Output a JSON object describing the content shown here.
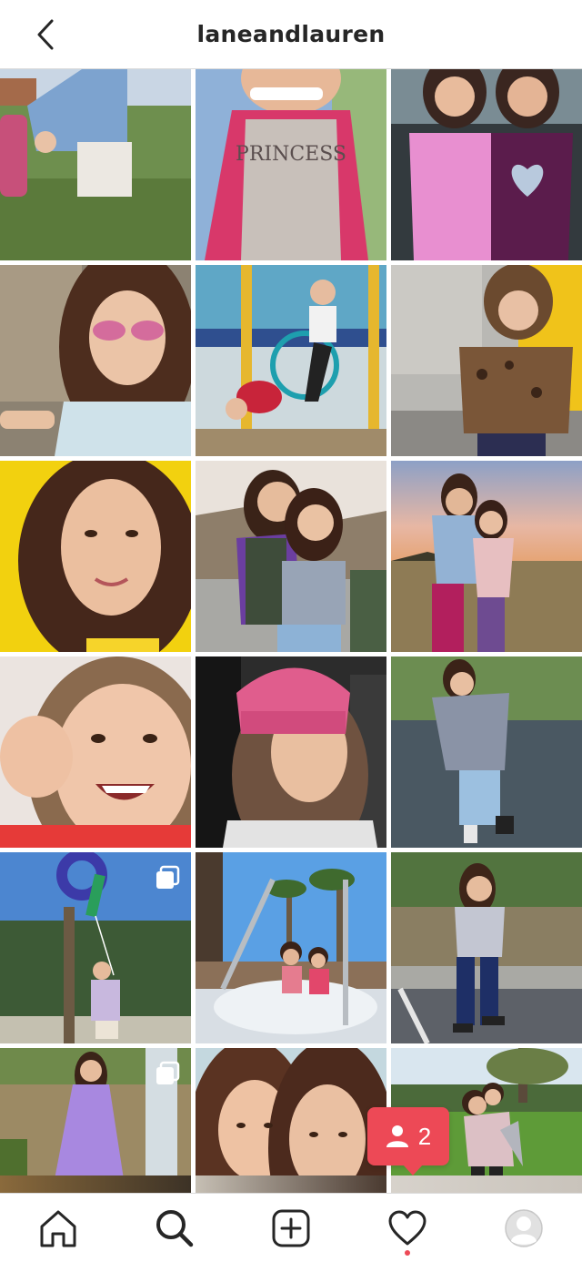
{
  "header": {
    "title": "laneandlauren"
  },
  "colors": {
    "accent": "#ed4956",
    "text": "#262626",
    "border": "#dbdbdb"
  },
  "grid": {
    "tiles": [
      {
        "scene": "girl-denim-jacket-park",
        "multi": false
      },
      {
        "scene": "girl-princess-shirt",
        "multi": false
      },
      {
        "scene": "two-girls-pink-purple",
        "multi": false
      },
      {
        "scene": "girl-pink-sunglasses",
        "multi": false
      },
      {
        "scene": "girls-playground-climbing",
        "multi": false
      },
      {
        "scene": "girl-leopard-coat-yellow-door",
        "multi": false
      },
      {
        "scene": "girl-portrait-yellow-background",
        "multi": false
      },
      {
        "scene": "two-girls-hugging-sunset-path",
        "multi": false
      },
      {
        "scene": "two-girls-sunset-field",
        "multi": false
      },
      {
        "scene": "girl-smiling-closeup",
        "multi": false
      },
      {
        "scene": "girl-pink-beanie-car",
        "multi": false
      },
      {
        "scene": "girl-posing-parking-lot",
        "multi": false
      },
      {
        "scene": "girl-number-9-balloon",
        "multi": true
      },
      {
        "scene": "two-girls-hot-tub-palms",
        "multi": false
      },
      {
        "scene": "girl-standing-dirt-lot",
        "multi": false
      },
      {
        "scene": "girl-purple-dress-tree",
        "multi": true
      },
      {
        "scene": "two-girls-closeup-portrait",
        "multi": false
      },
      {
        "scene": "girls-piggyback-park",
        "multi": false
      }
    ]
  },
  "notification": {
    "icon": "person-icon",
    "count": "2"
  },
  "bottom_nav": {
    "items": [
      "home-icon",
      "search-icon",
      "new-post-icon",
      "activity-heart-icon",
      "profile-avatar-icon"
    ]
  }
}
